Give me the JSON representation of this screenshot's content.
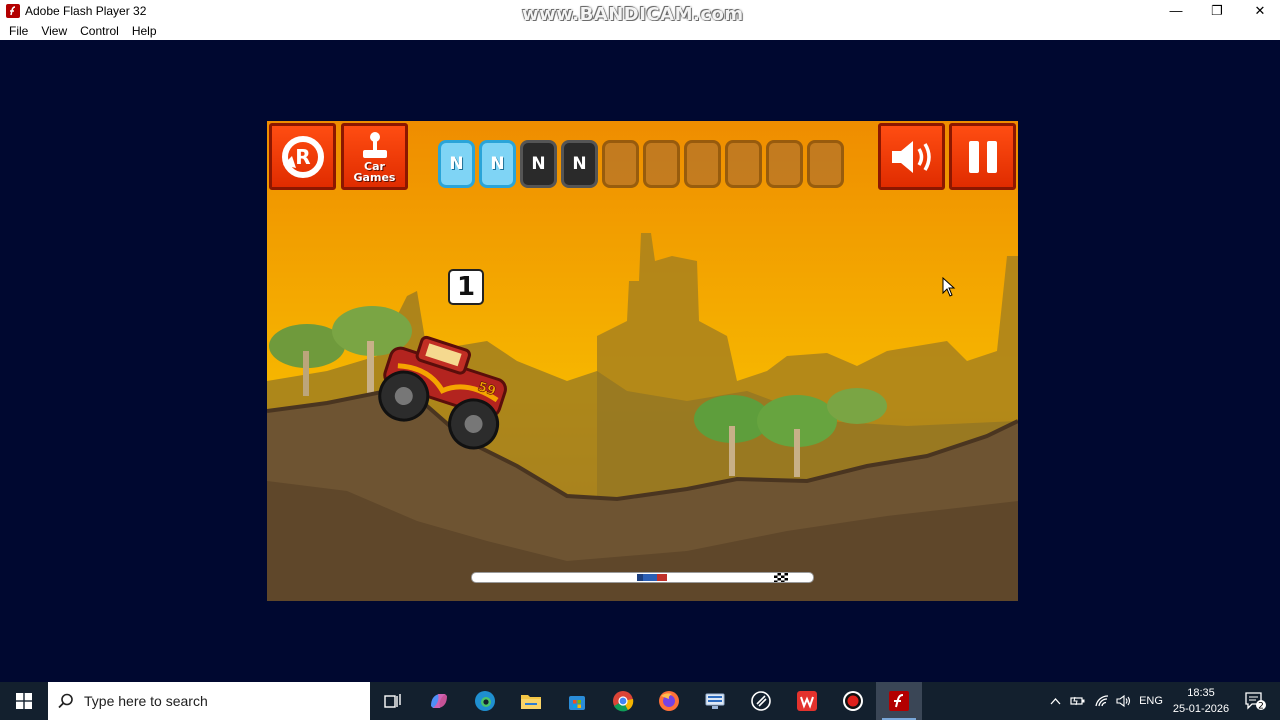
{
  "window": {
    "title": "Adobe Flash Player 32",
    "watermark": "www.BANDICAM.com",
    "minimize_glyph": "—",
    "maximize_glyph": "❐",
    "close_glyph": "✕"
  },
  "menu": {
    "items": [
      {
        "label": "File"
      },
      {
        "label": "View"
      },
      {
        "label": "Control"
      },
      {
        "label": "Help"
      }
    ]
  },
  "game": {
    "restart_button": {
      "letter": "R",
      "icon": "restart-icon"
    },
    "car_games_button": {
      "label_line1": "Car",
      "label_line2": "Games",
      "icon": "joystick-icon"
    },
    "nitro_slots": [
      {
        "label": "N",
        "state": "full"
      },
      {
        "label": "N",
        "state": "full"
      },
      {
        "label": "N",
        "state": "used"
      },
      {
        "label": "N",
        "state": "used"
      },
      {
        "label": "",
        "state": "empty"
      },
      {
        "label": "",
        "state": "empty"
      },
      {
        "label": "",
        "state": "empty"
      },
      {
        "label": "",
        "state": "empty"
      },
      {
        "label": "",
        "state": "empty"
      },
      {
        "label": "",
        "state": "empty"
      }
    ],
    "sound_button": {
      "icon": "speaker-icon"
    },
    "pause_button": {
      "icon": "pause-icon"
    },
    "race_position": "1",
    "truck_number": "59",
    "track_progress": 0.56,
    "colors": {
      "hud_orange": "#ff4d12",
      "sky": "#f2a000",
      "nitro_blue": "#7fd4f5"
    }
  },
  "taskbar": {
    "search_placeholder": "Type here to search",
    "apps": [
      "task-view-icon",
      "copilot-icon",
      "edge-icon",
      "file-explorer-icon",
      "microsoft-store-icon",
      "chrome-icon",
      "firefox-icon",
      "network-app-icon",
      "unknown-app-icon",
      "wps-office-icon",
      "bandicam-record-icon",
      "flash-player-icon"
    ],
    "language": "ENG",
    "time": "18:35",
    "date": "25-01-2026",
    "notification_count": "2"
  }
}
